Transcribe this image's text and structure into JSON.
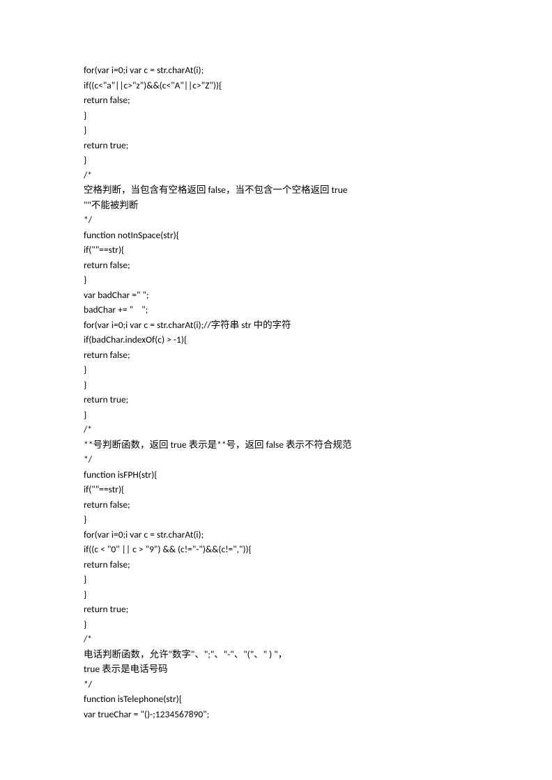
{
  "lines": [
    "for(var i=0;i var c = str.charAt(i);",
    "if((c<\"a\"||c>\"z\")&&(c<\"A\"||c>\"Z\")){",
    "return false;",
    "}",
    "}",
    "return true;",
    "}",
    "/*",
    "空格判断，当包含有空格返回 false，当不包含一个空格返回 true",
    "\"\"不能被判断",
    "*/",
    "function notInSpace(str){",
    "if(\"\"==str){",
    "return false;",
    "}",
    "var badChar =\" \";",
    "badChar += \"    \";",
    "for(var i=0;i var c = str.charAt(i);//字符串 str 中的字符",
    "if(badChar.indexOf(c) > -1){",
    "return false;",
    "}",
    "}",
    "return true;",
    "}",
    "/*",
    "**号判断函数，返回 true 表示是**号，返回 false 表示不符合规范",
    "*/",
    "function isFPH(str){",
    "if(\"\"==str){",
    "return false;",
    "}",
    "for(var i=0;i var c = str.charAt(i);",
    "if((c < \"0\" || c > \"9\") && (c!=\"-\")&&(c!=\",\")){",
    "return false;",
    "}",
    "}",
    "return true;",
    "}",
    "/*",
    "电话判断函数，允许\"数字\"、\";\"、\"-\"、\"(\"、\" ) \"，",
    "true 表示是电话号码",
    "*/",
    "function isTelephone(str){",
    "var trueChar = \"()-;1234567890\";"
  ]
}
